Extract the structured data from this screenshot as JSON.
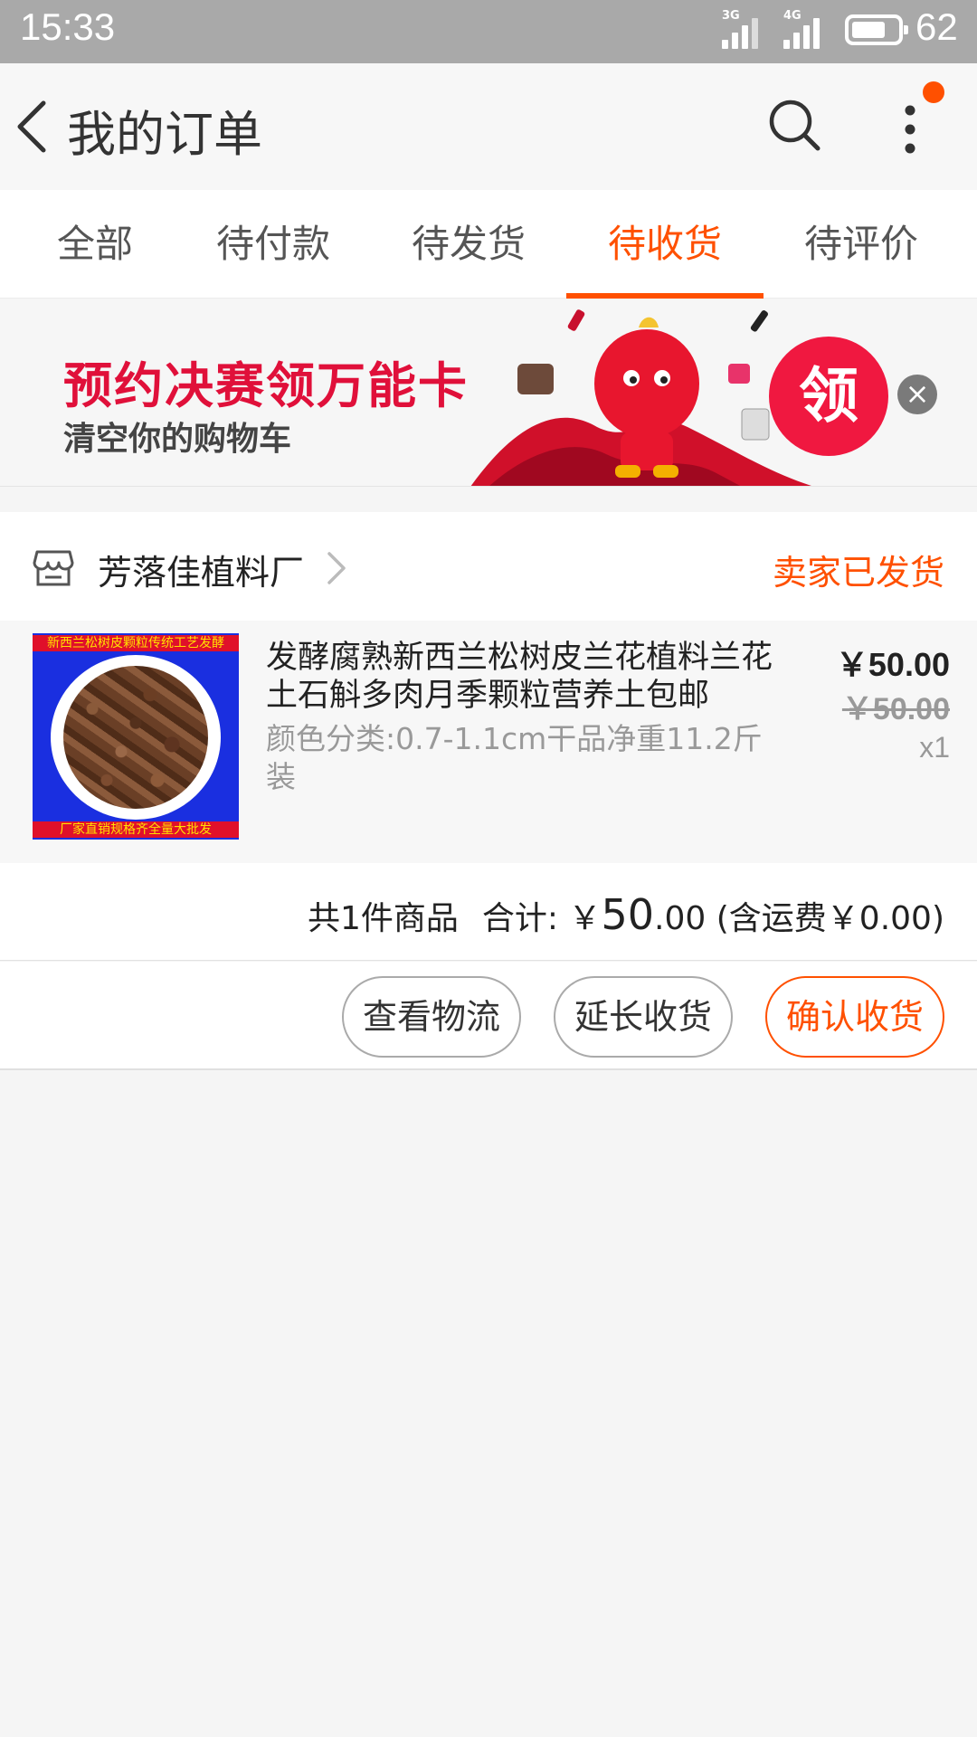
{
  "status_bar": {
    "time": "15:33",
    "network_1": "3G",
    "network_2": "4G",
    "battery": "62"
  },
  "nav": {
    "title": "我的订单"
  },
  "tabs": [
    {
      "label": "全部",
      "active": false
    },
    {
      "label": "待付款",
      "active": false
    },
    {
      "label": "待发货",
      "active": false
    },
    {
      "label": "待收货",
      "active": true
    },
    {
      "label": "待评价",
      "active": false
    }
  ],
  "banner": {
    "headline": "预约决赛领万能卡",
    "subline": "清空你的购物车",
    "claim_label": "领"
  },
  "order": {
    "shop_name": "芳落佳植料厂",
    "status": "卖家已发货",
    "item": {
      "image_top_text": "新西兰松树皮颗粒传统工艺发酵",
      "image_bottom_text": "厂家直销规格齐全量大批发",
      "title": "发酵腐熟新西兰松树皮兰花植料兰花土石斛多肉月季颗粒营养土包邮",
      "sku": "颜色分类:0.7-1.1cm干品净重11.2斤装",
      "price": "￥50.00",
      "original_price": "￥50.00",
      "quantity": "x1"
    },
    "summary": {
      "count_text": "共1件商品",
      "total_label": "合计: ￥",
      "total_int": "50",
      "total_dec": ".00",
      "shipping_text": "(含运费￥0.00)"
    },
    "actions": {
      "logistics": "查看物流",
      "extend": "延长收货",
      "confirm": "确认收货"
    }
  },
  "colors": {
    "accent": "#ff5000",
    "banner_red": "#e0103a"
  }
}
